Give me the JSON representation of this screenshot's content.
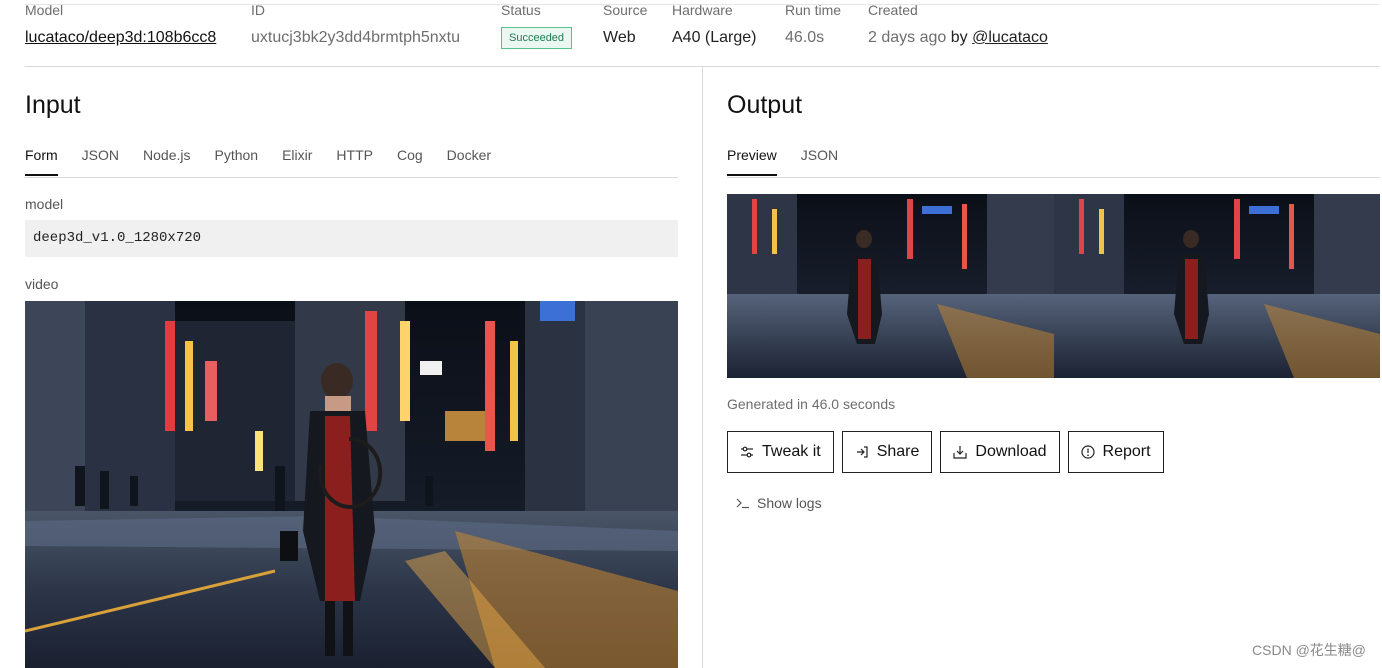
{
  "meta": {
    "model": {
      "label": "Model",
      "value": "lucataco/deep3d:108b6cc8"
    },
    "id": {
      "label": "ID",
      "value": "uxtucj3bk2y3dd4brmtph5nxtu"
    },
    "status": {
      "label": "Status",
      "value": "Succeeded"
    },
    "source": {
      "label": "Source",
      "value": "Web"
    },
    "hardware": {
      "label": "Hardware",
      "value": "A40 (Large)"
    },
    "run_time": {
      "label": "Run time",
      "value": "46.0s"
    },
    "created": {
      "label": "Created",
      "value": "2 days ago",
      "by": "by",
      "user": "@lucataco"
    }
  },
  "input": {
    "title": "Input",
    "tabs": [
      "Form",
      "JSON",
      "Node.js",
      "Python",
      "Elixir",
      "HTTP",
      "Cog",
      "Docker"
    ],
    "fields": {
      "model": {
        "label": "model",
        "value": "deep3d_v1.0_1280x720"
      },
      "video": {
        "label": "video"
      }
    }
  },
  "output": {
    "title": "Output",
    "tabs": [
      "Preview",
      "JSON"
    ],
    "generated_text": "Generated in 46.0 seconds",
    "actions": [
      "Tweak it",
      "Share",
      "Download",
      "Report"
    ],
    "show_logs": "Show logs"
  },
  "watermark": "CSDN @花生糖@",
  "icons": [
    "sliders-icon",
    "share-icon",
    "download-icon",
    "report-icon",
    "terminal-icon",
    "spinner-icon"
  ],
  "colors": {
    "status_green": "#58c08d",
    "text": "#111111",
    "muted": "#6e6e6e"
  }
}
